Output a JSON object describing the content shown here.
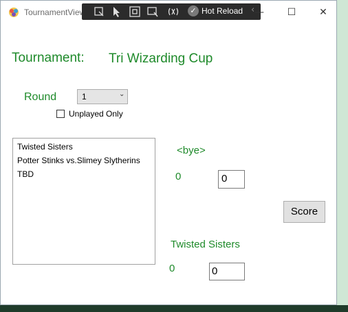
{
  "window": {
    "title": "TournamentViewer",
    "minimize_icon": "—",
    "maximize_icon": "☐",
    "close_icon": "✕"
  },
  "hot_reload_toolbar": {
    "label": "Hot Reload",
    "check_icon": "✓",
    "chevron_icon": "‹"
  },
  "tournament": {
    "label": "Tournament:",
    "name": "Tri Wizarding Cup"
  },
  "round": {
    "label": "Round",
    "selected": "1",
    "dropdown_icon": "⌄"
  },
  "filter": {
    "unplayed_only_label": "Unplayed Only",
    "unplayed_only_checked": false
  },
  "matchups": [
    "Twisted Sisters",
    "Potter Stinks vs.Slimey Slytherins",
    "TBD"
  ],
  "team_one": {
    "name": "<bye>",
    "score_label": "0",
    "score_value": "0"
  },
  "team_two": {
    "name": "Twisted Sisters",
    "score_label": "0",
    "score_value": "0"
  },
  "score_button_label": "Score",
  "colors": {
    "accent_green": "#1e8a2a",
    "toolbar_bg": "#2b2b2b"
  }
}
